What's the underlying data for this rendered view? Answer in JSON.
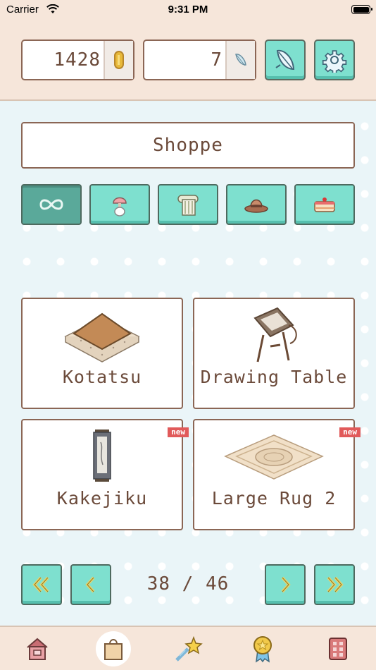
{
  "status_bar": {
    "carrier": "Carrier",
    "time": "9:31 PM"
  },
  "header": {
    "coins": "1428",
    "coin_icon": "coin-icon",
    "feathers": "7",
    "feather_icon": "feather-icon",
    "feather_button_icon": "feather-icon",
    "settings_button_icon": "gear-icon"
  },
  "shop": {
    "title": "Shoppe"
  },
  "categories": [
    {
      "icon": "infinity-icon",
      "active": true
    },
    {
      "icon": "lamp-icon",
      "active": false
    },
    {
      "icon": "wallpaper-roll-icon",
      "active": false
    },
    {
      "icon": "hat-icon",
      "active": false
    },
    {
      "icon": "cake-icon",
      "active": false
    }
  ],
  "items": [
    {
      "name": "Kotatsu",
      "badge": ""
    },
    {
      "name": "Drawing Table",
      "badge": ""
    },
    {
      "name": "Kakejiku",
      "badge": "new"
    },
    {
      "name": "Large Rug 2",
      "badge": "new"
    }
  ],
  "pager": {
    "current": 38,
    "total": 46,
    "label": "38 / 46"
  },
  "tabs": [
    {
      "icon": "house-icon",
      "active": false
    },
    {
      "icon": "shopping-bag-icon",
      "active": true
    },
    {
      "icon": "shooting-star-icon",
      "active": false
    },
    {
      "icon": "medal-icon",
      "active": false
    },
    {
      "icon": "dice-icon",
      "active": false
    }
  ],
  "colors": {
    "accent": "#7ee0cf",
    "accent_active": "#5aa99a",
    "text": "#6b4a3a",
    "header_bg": "#f6e6da",
    "badge": "#e15a5a"
  }
}
